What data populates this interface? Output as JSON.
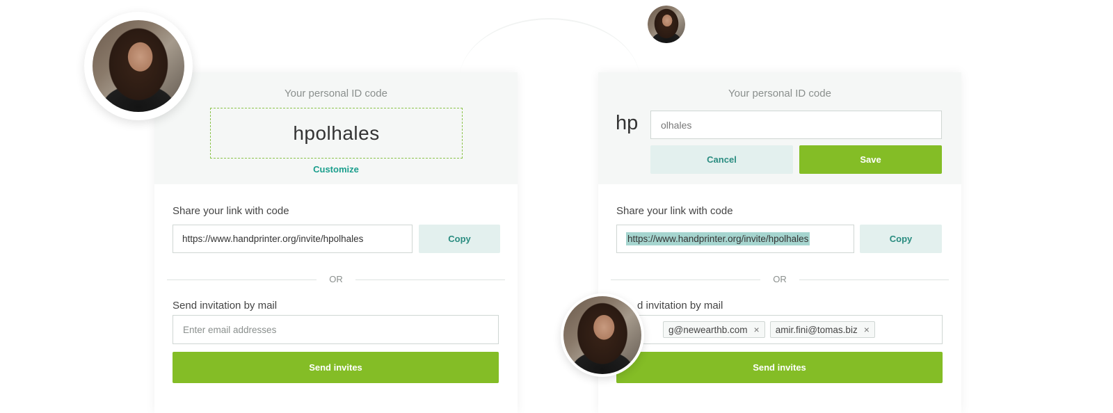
{
  "left_card": {
    "id_label": "Your personal ID code",
    "code": "hpolhales",
    "customize_label": "Customize",
    "share_label": "Share your link with code",
    "link_url": "https://www.handprinter.org/invite/hpolhales",
    "copy_label": "Copy",
    "or_text": "OR",
    "mail_label": "Send invitation by mail",
    "email_placeholder": "Enter email addresses",
    "send_label": "Send invites"
  },
  "right_card": {
    "id_label": "Your personal ID code",
    "prefix": "hp",
    "code_input_value": "olhales",
    "cancel_label": "Cancel",
    "save_label": "Save",
    "share_label": "Share your link with code",
    "link_url": "https://www.handprinter.org/invite/hpolhales",
    "copy_label": "Copy",
    "or_text": "OR",
    "mail_label": "d invitation by mail",
    "email_tags": [
      "g@newearthb.com",
      "amir.fini@tomas.biz"
    ],
    "tag_remove": "×",
    "send_label": "Send invites"
  },
  "colors": {
    "accent_green": "#84bd26",
    "teal_text": "#1a9e8c",
    "light_teal_bg": "#e3f0ee",
    "panel_bg": "#f5f7f6"
  }
}
